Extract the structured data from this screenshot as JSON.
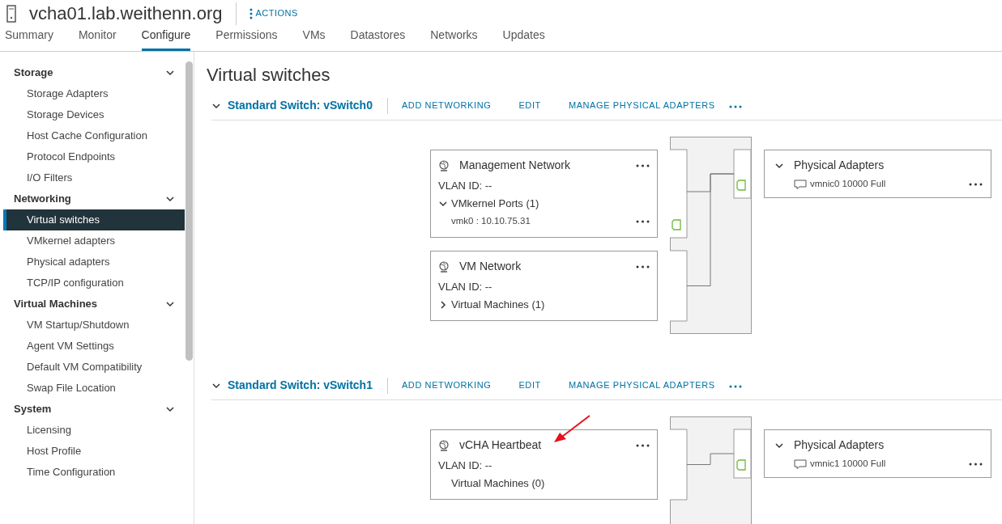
{
  "host": {
    "title": "vcha01.lab.weithenn.org",
    "actions": "ACTIONS"
  },
  "tabs": [
    {
      "label": "Summary",
      "selected": false
    },
    {
      "label": "Monitor",
      "selected": false
    },
    {
      "label": "Configure",
      "selected": true
    },
    {
      "label": "Permissions",
      "selected": false
    },
    {
      "label": "VMs",
      "selected": false
    },
    {
      "label": "Datastores",
      "selected": false
    },
    {
      "label": "Networks",
      "selected": false
    },
    {
      "label": "Updates",
      "selected": false
    }
  ],
  "sidebar": {
    "groups": [
      {
        "label": "Storage",
        "expanded": true,
        "items": [
          {
            "label": "Storage Adapters",
            "selected": false
          },
          {
            "label": "Storage Devices",
            "selected": false
          },
          {
            "label": "Host Cache Configuration",
            "selected": false
          },
          {
            "label": "Protocol Endpoints",
            "selected": false
          },
          {
            "label": "I/O Filters",
            "selected": false
          }
        ]
      },
      {
        "label": "Networking",
        "expanded": true,
        "items": [
          {
            "label": "Virtual switches",
            "selected": true
          },
          {
            "label": "VMkernel adapters",
            "selected": false
          },
          {
            "label": "Physical adapters",
            "selected": false
          },
          {
            "label": "TCP/IP configuration",
            "selected": false
          }
        ]
      },
      {
        "label": "Virtual Machines",
        "expanded": true,
        "items": [
          {
            "label": "VM Startup/Shutdown",
            "selected": false
          },
          {
            "label": "Agent VM Settings",
            "selected": false
          },
          {
            "label": "Default VM Compatibility",
            "selected": false
          },
          {
            "label": "Swap File Location",
            "selected": false
          }
        ]
      },
      {
        "label": "System",
        "expanded": true,
        "items": [
          {
            "label": "Licensing",
            "selected": false
          },
          {
            "label": "Host Profile",
            "selected": false
          },
          {
            "label": "Time Configuration",
            "selected": false
          }
        ]
      }
    ]
  },
  "page_title": "Virtual switches",
  "switches": [
    {
      "title": "Standard Switch: vSwitch0",
      "expanded": true,
      "actions": [
        "ADD NETWORKING",
        "EDIT",
        "MANAGE PHYSICAL ADAPTERS"
      ],
      "port_groups": [
        {
          "name": "Management Network",
          "highlighted": false,
          "vlan": "VLAN ID: --",
          "sections": [
            {
              "kind": "expander",
              "label": "VMkernel Ports (1)",
              "expanded": true,
              "children": [
                {
                  "label": "vmk0 : 10.10.75.31"
                }
              ]
            }
          ]
        },
        {
          "name": "VM Network",
          "highlighted": false,
          "vlan": "VLAN ID: --",
          "sections": [
            {
              "kind": "expander",
              "label": "Virtual Machines (1)",
              "expanded": false
            }
          ]
        }
      ],
      "adapters": {
        "title": "Physical Adapters",
        "expanded": true,
        "items": [
          {
            "label": "vmnic0 10000 Full"
          }
        ]
      }
    },
    {
      "title": "Standard Switch: vSwitch1",
      "expanded": true,
      "actions": [
        "ADD NETWORKING",
        "EDIT",
        "MANAGE PHYSICAL ADAPTERS"
      ],
      "port_groups": [
        {
          "name": "vCHA Heartbeat",
          "highlighted": true,
          "vlan": "VLAN ID: --",
          "sections": [
            {
              "kind": "plain",
              "label": "Virtual Machines (0)"
            }
          ]
        }
      ],
      "adapters": {
        "title": "Physical Adapters",
        "expanded": true,
        "items": [
          {
            "label": "vmnic1 10000 Full"
          }
        ]
      }
    }
  ]
}
